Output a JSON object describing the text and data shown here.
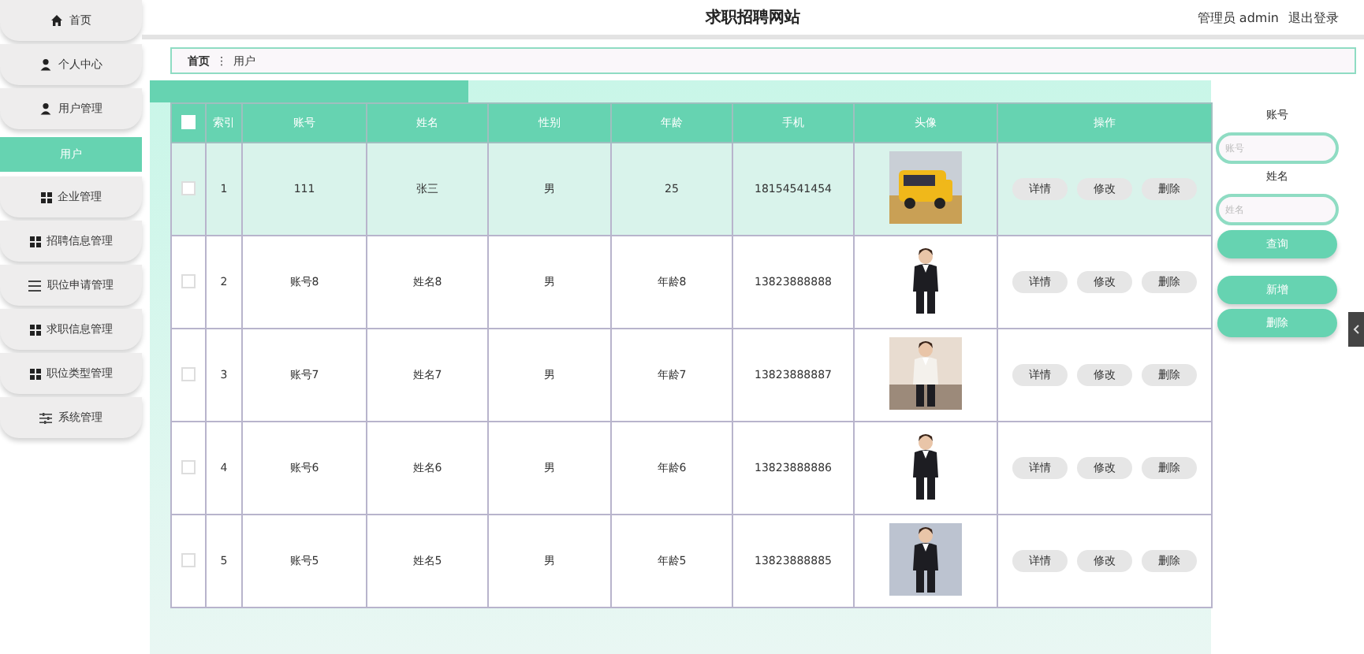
{
  "header": {
    "title": "求职招聘网站",
    "user": "管理员 admin",
    "logout": "退出登录"
  },
  "sidebar": {
    "items": [
      {
        "label": "首页",
        "kind": "home",
        "selected": false
      },
      {
        "label": "个人中心",
        "kind": "person",
        "selected": false
      },
      {
        "label": "用户管理",
        "kind": "person",
        "selected": false
      },
      {
        "label": "用户",
        "kind": "subitem",
        "selected": true
      },
      {
        "label": "企业管理",
        "kind": "grid",
        "selected": false
      },
      {
        "label": "招聘信息管理",
        "kind": "grid",
        "selected": false
      },
      {
        "label": "职位申请管理",
        "kind": "list",
        "selected": false
      },
      {
        "label": "求职信息管理",
        "kind": "grid",
        "selected": false
      },
      {
        "label": "职位类型管理",
        "kind": "grid",
        "selected": false
      },
      {
        "label": "系统管理",
        "kind": "sliders",
        "selected": false
      }
    ]
  },
  "breadcrumb": {
    "home": "首页",
    "separator": "⋮",
    "current": "用户"
  },
  "table": {
    "columns": [
      "索引",
      "账号",
      "姓名",
      "性别",
      "年龄",
      "手机",
      "头像",
      "操作"
    ],
    "all_checked": false,
    "rows": [
      {
        "index": "1",
        "account": "111",
        "name": "张三",
        "gender": "男",
        "age": "25",
        "phone": "18154541454",
        "actions": [
          "详情",
          "修改",
          "删除"
        ],
        "checked": false,
        "highlighted": true
      },
      {
        "index": "2",
        "account": "账号8",
        "name": "姓名8",
        "gender": "男",
        "age": "年龄8",
        "phone": "13823888888",
        "actions": [
          "详情",
          "修改",
          "删除"
        ],
        "checked": false,
        "highlighted": false
      },
      {
        "index": "3",
        "account": "账号7",
        "name": "姓名7",
        "gender": "男",
        "age": "年龄7",
        "phone": "13823888887",
        "actions": [
          "详情",
          "修改",
          "删除"
        ],
        "checked": false,
        "highlighted": false
      },
      {
        "index": "4",
        "account": "账号6",
        "name": "姓名6",
        "gender": "男",
        "age": "年龄6",
        "phone": "13823888886",
        "actions": [
          "详情",
          "修改",
          "删除"
        ],
        "checked": false,
        "highlighted": false
      },
      {
        "index": "5",
        "account": "账号5",
        "name": "姓名5",
        "gender": "男",
        "age": "年龄5",
        "phone": "13823888885",
        "actions": [
          "详情",
          "修改",
          "删除"
        ],
        "checked": false,
        "highlighted": false
      }
    ]
  },
  "search": {
    "fields": [
      {
        "label": "账号",
        "placeholder": "账号"
      },
      {
        "label": "姓名",
        "placeholder": "姓名"
      }
    ],
    "query_button": "查询",
    "buttons": [
      "新增",
      "删除"
    ]
  }
}
